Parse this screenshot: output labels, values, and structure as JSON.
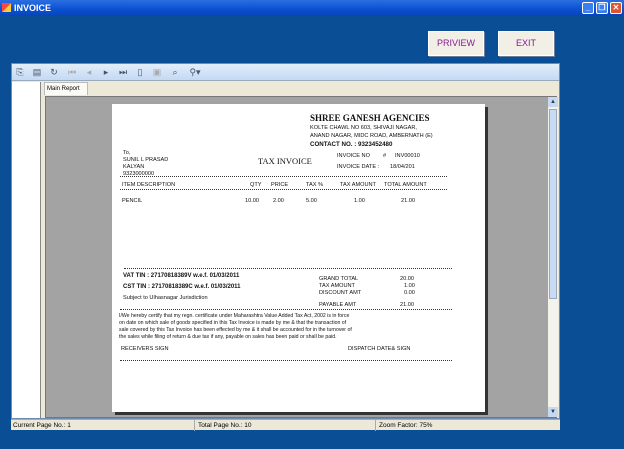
{
  "window": {
    "title": "INVOICE"
  },
  "buttons": {
    "preview": "PRIVIEW",
    "exit": "EXIT"
  },
  "viewer": {
    "tab": "Main Report"
  },
  "report": {
    "company": "SHREE GANESH AGENCIES",
    "address1": "KOLTE CHAWL NO 603, SHIVAJI NAGAR,",
    "address2": "ANAND NAGAR, MIDC ROAD, AMBERNATH (E)",
    "contact": "CONTACT NO. : 9323452480",
    "to": "To,",
    "customer_name": "SUNIL L PRASAD",
    "customer_city": "KALYAN",
    "customer_phone": "9323000000",
    "title": "TAX INVOICE",
    "invoice_no_label": "INVOICE NO",
    "invoice_no_hash": "#",
    "invoice_no": "INV00010",
    "invoice_date_label": "INVOICE DATE :",
    "invoice_date": "18/04/201",
    "columns": [
      "ITEM DESCRIPTION",
      "QTY",
      "PRICE",
      "TAX %",
      "TAX AMOUNT",
      "TOTAL AMOUNT"
    ],
    "rows": [
      [
        "PENCIL",
        "10.00",
        "2.00",
        "5.00",
        "1.00",
        "21.00"
      ]
    ],
    "vat_tin": "VAT TIN : 27170818389V  w.e.f. 01/03/2011",
    "cst_tin": "CST TIN : 27170818389C  w.e.f. 01/03/2011",
    "jurisdiction": "Subject to Ulhasnagar Jurisdiction",
    "totals": [
      {
        "label": "GRAND TOTAL",
        "value": "20.00"
      },
      {
        "label": "TAX AMOUNT",
        "value": "1.00"
      },
      {
        "label": "DISCOUNT AMT",
        "value": "0.00"
      },
      {
        "label": "PAYABLE AMT",
        "value": "21.00"
      }
    ],
    "declaration": [
      "I/We hereby certify that my regn. certificate under Maharashtra Value Added Tax Act, 2002 is in force",
      "on date on which sale of goods specified in this Tax Invoice is made by me & that the transaction of",
      "sale covered by this Tax Invoice has been effected by me & it shall be accounted for in the turnover of",
      "the sales while filing of return & due tax if any, payable on sales has been paid or shall be paid."
    ],
    "receivers_sign": "RECEIVERS SIGN",
    "dispatch_sign": "DISPATCH DATE& SIGN"
  },
  "status": {
    "current_page": "Current Page No.: 1",
    "total_page": "Total Page No.: 10",
    "zoom": "Zoom Factor: 75%"
  }
}
